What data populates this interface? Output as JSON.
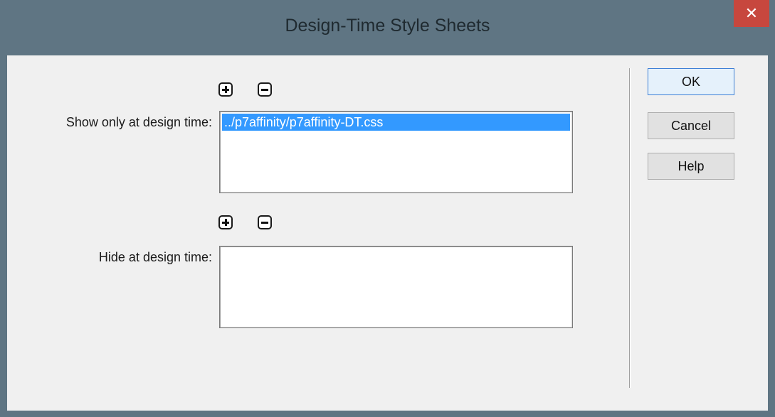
{
  "window": {
    "title": "Design-Time Style Sheets",
    "close_glyph": "✕"
  },
  "show_section": {
    "label": "Show only at design time:",
    "add_icon": "plus-icon",
    "remove_icon": "minus-icon",
    "items": [
      "../p7affinity/p7affinity-DT.css"
    ],
    "selected_index": 0
  },
  "hide_section": {
    "label": "Hide at design time:",
    "add_icon": "plus-icon",
    "remove_icon": "minus-icon",
    "items": []
  },
  "buttons": {
    "ok": "OK",
    "cancel": "Cancel",
    "help": "Help"
  },
  "colors": {
    "selection": "#3399ff",
    "close": "#c7473e",
    "frame": "#5f7583"
  }
}
